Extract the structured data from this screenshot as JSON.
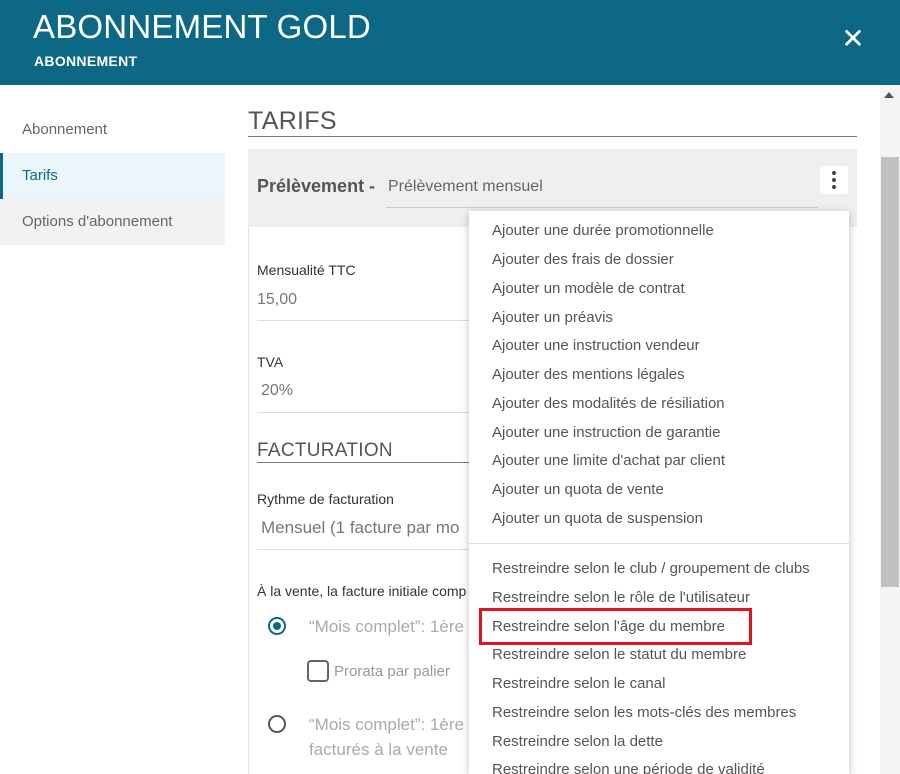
{
  "header": {
    "title": "ABONNEMENT GOLD",
    "subtitle": "ABONNEMENT",
    "close_symbol": "✕"
  },
  "sidebar": {
    "items": [
      {
        "label": "Abonnement"
      },
      {
        "label": "Tarifs"
      },
      {
        "label": "Options d'abonnement"
      }
    ]
  },
  "main": {
    "title": "TARIFS",
    "card": {
      "label": "Prélèvement -",
      "value": "Prélèvement mensuel"
    },
    "fields": {
      "mensualite_label": "Mensualité TTC",
      "mensualite_value": "15,00",
      "tva_label": "TVA",
      "tva_value": "20%"
    },
    "facturation": {
      "title": "FACTURATION",
      "rythme_label": "Rythme de facturation",
      "rythme_value": "Mensuel (1 facture par mo",
      "initial_text": "À la vente, la facture initiale comp",
      "option1": "“Mois complet”: 1ère",
      "prorata": "Prorata par palier",
      "option2_line1": "“Mois complet”: 1ère",
      "option2_line2": "facturés à la vente"
    }
  },
  "menu": {
    "group1": [
      "Ajouter une durée promotionnelle",
      "Ajouter des frais de dossier",
      "Ajouter un modèle de contrat",
      "Ajouter un préavis",
      "Ajouter une instruction vendeur",
      "Ajouter des mentions légales",
      "Ajouter des modalités de résiliation",
      "Ajouter une instruction de garantie",
      "Ajouter une limite d'achat par client",
      "Ajouter un quota de vente",
      "Ajouter un quota de suspension"
    ],
    "group2": [
      "Restreindre selon le club / groupement de clubs",
      "Restreindre selon le rôle de l'utilisateur",
      "Restreindre selon l'âge du membre",
      "Restreindre selon le statut du membre",
      "Restreindre selon le canal",
      "Restreindre selon les mots-clés des membres",
      "Restreindre selon la dette",
      "Restreindre selon une période de validité"
    ]
  },
  "colors": {
    "brand": "#0d6886",
    "highlight": "#e0141e"
  }
}
